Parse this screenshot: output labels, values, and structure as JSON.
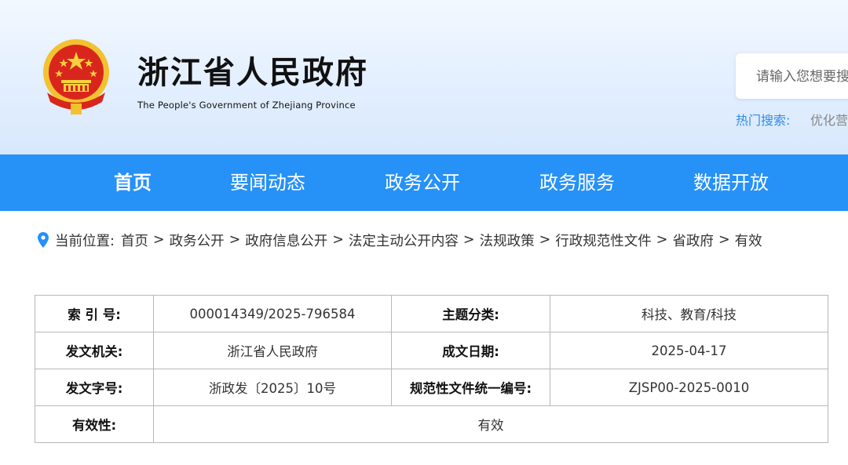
{
  "header": {
    "title": "浙江省人民政府",
    "subtitle": "The People's Government of Zhejiang Province",
    "search_placeholder": "请输入您想要搜",
    "hot_search_label": "热门搜索:",
    "hot_search_item": "优化营"
  },
  "nav": {
    "items": [
      "首页",
      "要闻动态",
      "政务公开",
      "政务服务",
      "数据开放"
    ]
  },
  "breadcrumb": {
    "label": "当前位置:",
    "items": [
      "首页",
      "政务公开",
      "政府信息公开",
      "法定主动公开内容",
      "法规政策",
      "行政规范性文件",
      "省政府",
      "有效"
    ],
    "separator": ">"
  },
  "meta_table": {
    "index_label": "索 引 号:",
    "index_value": "000014349/2025-796584",
    "topic_label": "主题分类:",
    "topic_value": "科技、教育/科技",
    "issuer_label": "发文机关:",
    "issuer_value": "浙江省人民政府",
    "date_label": "成文日期:",
    "date_value": "2025-04-17",
    "docno_label": "发文字号:",
    "docno_value": "浙政发〔2025〕10号",
    "code_label": "规范性文件统一编号:",
    "code_value": "ZJSP00-2025-0010",
    "validity_label": "有效性:",
    "validity_value": "有效"
  },
  "colors": {
    "nav_bg": "#2691f7",
    "header_bg": "#e3efff",
    "link_blue": "#2f8de4",
    "emblem_red": "#d9261c",
    "emblem_gold": "#f2c230"
  },
  "icons": {
    "emblem": "national-emblem-icon",
    "location": "location-pin-icon"
  }
}
